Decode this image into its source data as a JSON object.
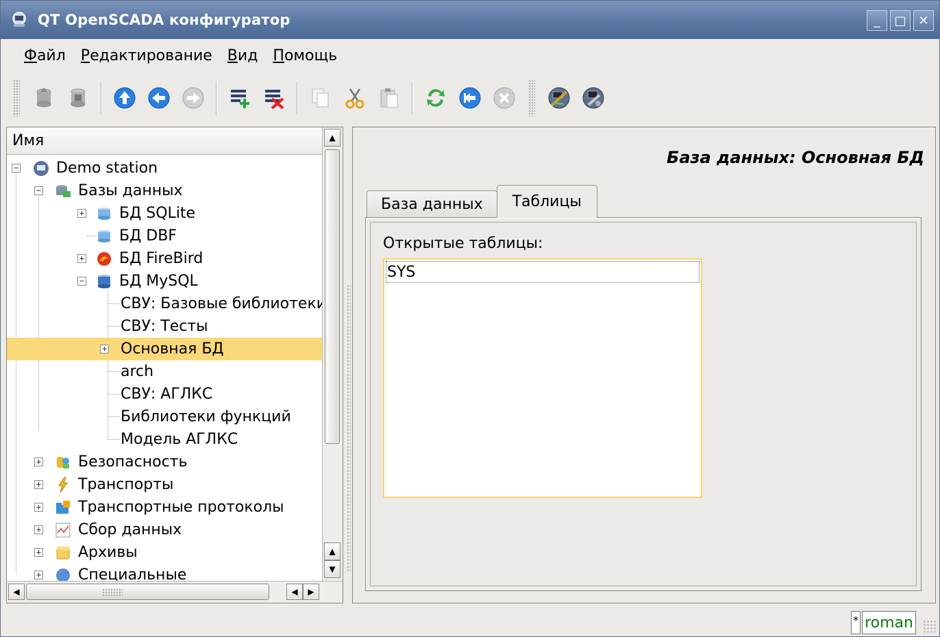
{
  "window": {
    "title": "QT OpenSCADA конфигуратор",
    "buttons": [
      "_",
      "□",
      "✕"
    ]
  },
  "menu": [
    "Файл",
    "Редактирование",
    "Вид",
    "Помощь"
  ],
  "toolbar": {
    "icons": [
      "db-load-icon",
      "db-save-icon",
      "up-icon",
      "back-icon",
      "forward-icon",
      "add-item-icon",
      "delete-item-icon",
      "copy-icon",
      "cut-icon",
      "paste-icon",
      "refresh-icon",
      "start-icon",
      "stop-icon",
      "tool-icon",
      "network-tool-icon"
    ]
  },
  "tree": {
    "header": "Имя",
    "items": [
      {
        "label": "Demo station",
        "icon": "station-icon"
      },
      {
        "label": "Базы данных",
        "icon": "databases-icon"
      },
      {
        "label": "БД SQLite",
        "icon": "db-icon"
      },
      {
        "label": "БД DBF",
        "icon": "db-icon"
      },
      {
        "label": "БД FireBird",
        "icon": "firebird-icon"
      },
      {
        "label": "БД MySQL",
        "icon": "mysql-icon"
      },
      {
        "label": "СВУ: Базовые библиотеки"
      },
      {
        "label": "СВУ: Тесты"
      },
      {
        "label": "Основная БД",
        "selected": true
      },
      {
        "label": "arch"
      },
      {
        "label": "СВУ: АГЛКС"
      },
      {
        "label": "Библиотеки функций"
      },
      {
        "label": "Модель АГЛКС"
      },
      {
        "label": "Безопасность",
        "icon": "security-icon"
      },
      {
        "label": "Транспорты",
        "icon": "transport-icon"
      },
      {
        "label": "Транспортные протоколы",
        "icon": "protocols-icon"
      },
      {
        "label": "Сбор данных",
        "icon": "daq-icon"
      },
      {
        "label": "Архивы",
        "icon": "archive-icon"
      },
      {
        "label": "Специальные",
        "icon": "special-icon"
      }
    ]
  },
  "page": {
    "title": "База данных: Основная БД",
    "tabs": [
      "База данных",
      "Таблицы"
    ],
    "active_tab": "Таблицы",
    "open_tables_label": "Открытые таблицы:",
    "open_tables": [
      "SYS"
    ]
  },
  "status": {
    "flag": "*",
    "user": "roman",
    "user_color": "#0a7a12"
  },
  "colors": {
    "selection": "#fbd97a",
    "titlebar": "#5a77a3",
    "focus_border": "#f4d774"
  }
}
